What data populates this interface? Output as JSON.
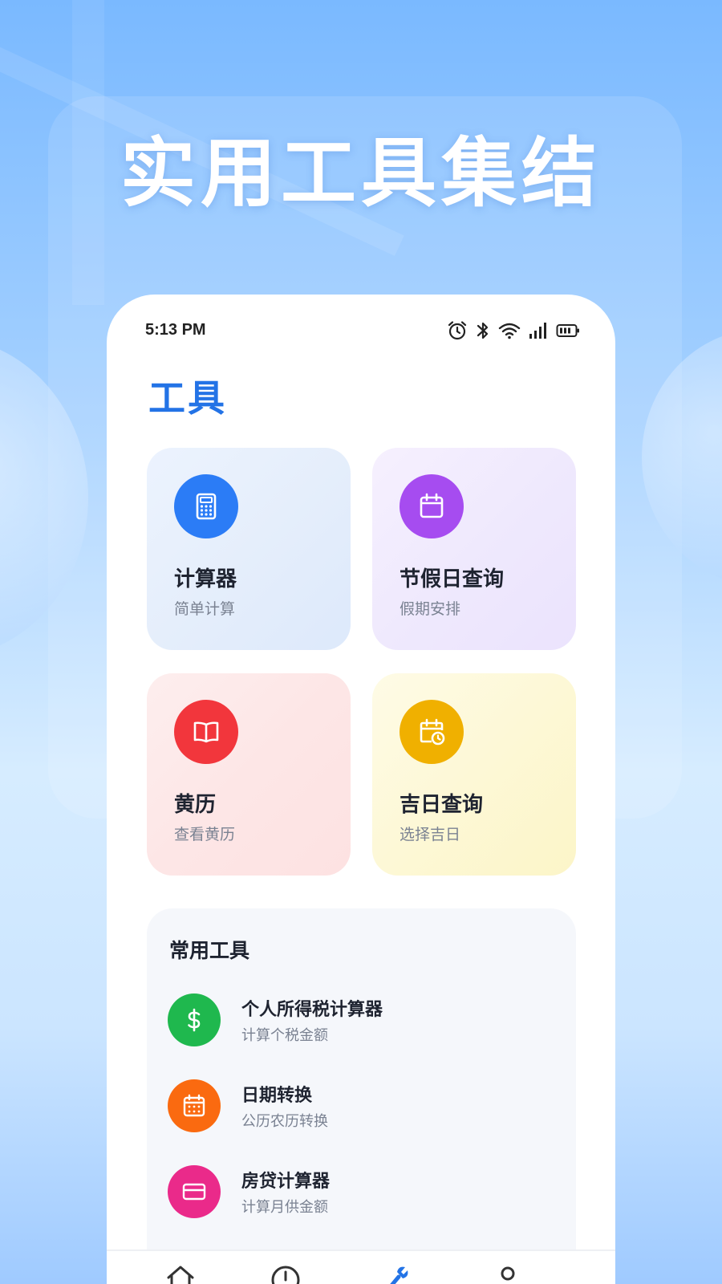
{
  "promo": {
    "headline": "实用工具集结"
  },
  "status_bar": {
    "time": "5:13 PM",
    "icons": [
      "alarm-icon",
      "bluetooth-icon",
      "wifi-icon",
      "signal-icon",
      "battery-icon"
    ]
  },
  "page": {
    "title": "工具"
  },
  "cards": [
    {
      "title": "计算器",
      "subtitle": "简单计算",
      "icon": "calculator-icon",
      "color": "#2b7cf6"
    },
    {
      "title": "节假日查询",
      "subtitle": "假期安排",
      "icon": "calendar-icon",
      "color": "#a64cf0"
    },
    {
      "title": "黄历",
      "subtitle": "查看黄历",
      "icon": "book-icon",
      "color": "#f2363c"
    },
    {
      "title": "吉日查询",
      "subtitle": "选择吉日",
      "icon": "calendar-clock-icon",
      "color": "#f0b000"
    }
  ],
  "common_tools": {
    "title": "常用工具",
    "items": [
      {
        "title": "个人所得税计算器",
        "subtitle": "计算个税金额",
        "icon": "dollar-icon",
        "color": "#1fb84e"
      },
      {
        "title": "日期转换",
        "subtitle": "公历农历转换",
        "icon": "calendar-grid-icon",
        "color": "#fa6a10"
      },
      {
        "title": "房贷计算器",
        "subtitle": "计算月供金额",
        "icon": "credit-card-icon",
        "color": "#ea2a8a"
      }
    ]
  },
  "tab_bar": {
    "tabs": [
      {
        "icon": "home-icon"
      },
      {
        "icon": "clock-icon"
      },
      {
        "icon": "tools-icon",
        "active": true
      },
      {
        "icon": "user-icon"
      }
    ],
    "active_color": "#2373e6",
    "inactive_color": "#333333"
  }
}
